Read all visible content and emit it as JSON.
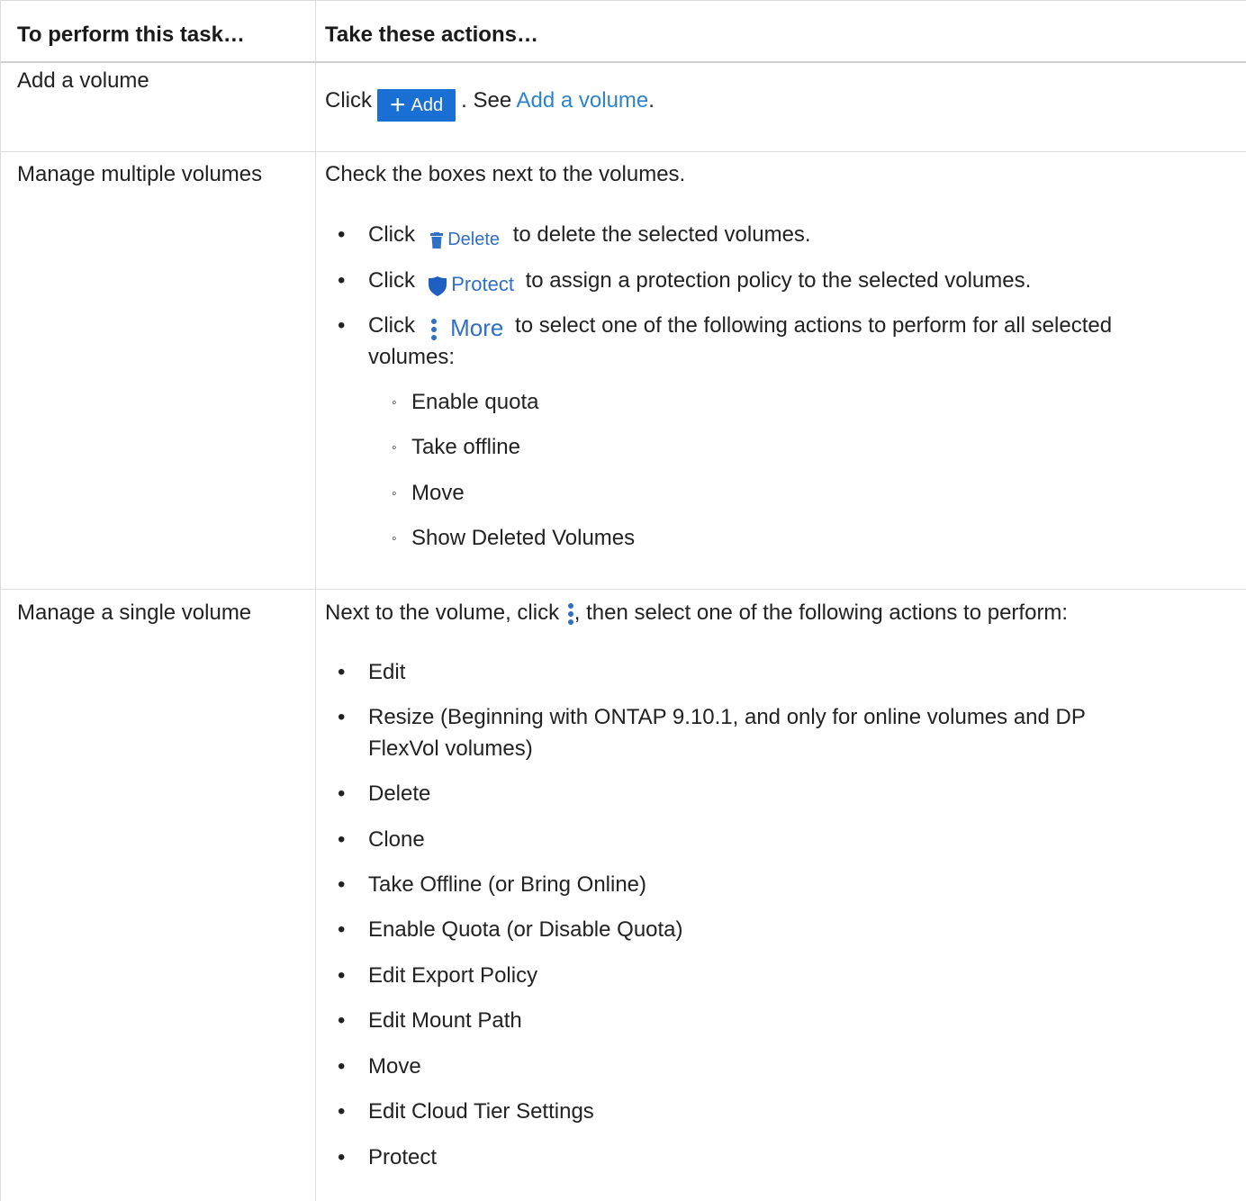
{
  "table": {
    "headers": [
      "To perform this task…",
      "Take these actions…"
    ],
    "row_add": {
      "task": "Add a volume",
      "click": "Click",
      "add_button_label": "Add",
      "see": ". See",
      "link": "Add a volume",
      "end": "."
    },
    "row_multi": {
      "task": "Manage multiple volumes",
      "intro": "Check the boxes next to the volumes.",
      "delete": {
        "pre": "Click",
        "button": "Delete",
        "post": "to delete the selected volumes."
      },
      "protect": {
        "pre": "Click",
        "button": "Protect",
        "post": "to assign a protection policy to the selected volumes."
      },
      "more": {
        "pre": "Click",
        "button": "More",
        "post_line1": "to select one of the following actions to perform for all selected",
        "post_line2": "volumes:"
      },
      "sub_items": [
        "Enable quota",
        "Take offline",
        "Move",
        "Show Deleted Volumes"
      ]
    },
    "row_single": {
      "task": "Manage a single volume",
      "intro_pre": "Next to the volume, click",
      "intro_post": ", then select one of the following actions to perform:",
      "items": [
        "Edit",
        "Resize (Beginning with ONTAP 9.10.1, and only for online volumes and DP",
        "FlexVol volumes)",
        "Delete",
        "Clone",
        "Take Offline (or Bring Online)",
        "Enable Quota (or Disable Quota)",
        "Edit Export Policy",
        "Edit Mount Path",
        "Move",
        "Edit Cloud Tier Settings",
        "Protect"
      ]
    }
  },
  "colors": {
    "link": "#2f84c8",
    "add_button_bg": "#1a6fd4",
    "action_icon": "#2f6fc4",
    "border": "#dcdcdc"
  },
  "icons": [
    "plus-icon",
    "trash-icon",
    "shield-icon",
    "vertical-dots-icon"
  ]
}
